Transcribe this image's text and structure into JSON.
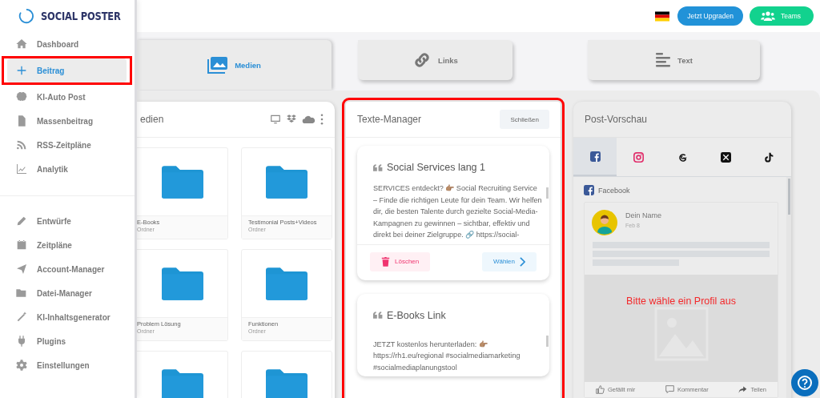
{
  "brand": {
    "name": "SOCIAL POSTER"
  },
  "header": {
    "buttons": [
      {
        "label": "Jetzt Upgraden",
        "kind": "upgrade"
      },
      {
        "label": "Teams",
        "kind": "teams"
      }
    ]
  },
  "sidebar": {
    "sections": [
      {
        "items": [
          {
            "label": "Dashboard",
            "selected": false,
            "highlighted": false
          },
          {
            "label": "Beitrag",
            "selected": true,
            "highlighted": true
          },
          {
            "label": "KI-Auto Post",
            "selected": false,
            "highlighted": false
          },
          {
            "label": "Massenbeitrag",
            "selected": false,
            "highlighted": false
          },
          {
            "label": "RSS-Zeitpläne",
            "selected": false,
            "highlighted": false
          },
          {
            "label": "Analytik",
            "selected": false,
            "highlighted": false
          }
        ]
      },
      {
        "items": [
          {
            "label": "Entwürfe",
            "selected": false,
            "highlighted": false
          },
          {
            "label": "Zeitpläne",
            "selected": false,
            "highlighted": false
          },
          {
            "label": "Account-Manager",
            "selected": false,
            "highlighted": false
          },
          {
            "label": "Datei-Manager",
            "selected": false,
            "highlighted": false
          },
          {
            "label": "KI-Inhaltsgenerator",
            "selected": false,
            "highlighted": false
          },
          {
            "label": "Plugins",
            "selected": false,
            "highlighted": false
          },
          {
            "label": "Einstellungen",
            "selected": false,
            "highlighted": false
          }
        ]
      }
    ]
  },
  "source_tabs": [
    {
      "label": "Medien",
      "selected": true
    },
    {
      "label": "Links",
      "selected": false
    },
    {
      "label": "Text",
      "selected": false
    }
  ],
  "media_panel": {
    "title": "edien",
    "folders": [
      {
        "kind": "folder",
        "name": "E-Books",
        "type": "Ordner"
      },
      {
        "kind": "folder",
        "name": "Testimonial Posts+Videos",
        "type": "Ordner"
      },
      {
        "kind": "folder",
        "name": "Problem Lösung",
        "type": "Ordner"
      },
      {
        "kind": "folder",
        "name": "Funktionen",
        "type": "Ordner"
      },
      {
        "kind": "folder"
      },
      {
        "kind": "folder"
      }
    ]
  },
  "texts_manager": {
    "title": "Texte-Manager",
    "close_label": "Schließen",
    "highlighted": true,
    "entries": [
      {
        "title": "Social Services lang 1",
        "body": "SERVICES entdeckt? 👉🏽 Social Recruiting Service – Finde die richtigen Leute für dein Team. Wir helfen dir, die besten Talente durch gezielte Social-Media-Kampagnen zu gewinnen – sichtbar, effektiv und direkt bei deiner Zielgruppe. 🔗 https://social-",
        "delete_label": "Löschen",
        "choose_label": "Wählen"
      },
      {
        "title": "E-Books Link",
        "body": "JETZT kostenlos herunterladen: 👉🏽 https://rh1.eu/regional #socialmediamarketing #socialmediaplanungstool"
      }
    ]
  },
  "preview": {
    "title": "Post-Vorschau",
    "networks": [
      {
        "kind": "facebook",
        "selected": true
      },
      {
        "kind": "instagram",
        "selected": false
      },
      {
        "kind": "threads",
        "selected": false
      },
      {
        "kind": "x",
        "selected": false
      },
      {
        "kind": "tiktok",
        "selected": false
      }
    ],
    "network_label": "Facebook",
    "post": {
      "name": "Dein Name",
      "date": "Feb 8",
      "message": "Bitte wähle ein Profil aus",
      "actions": [
        {
          "label": "Gefällt mir",
          "kind": "like"
        },
        {
          "label": "Kommentar",
          "kind": "comment"
        },
        {
          "label": "Teilen",
          "kind": "share"
        }
      ]
    }
  }
}
